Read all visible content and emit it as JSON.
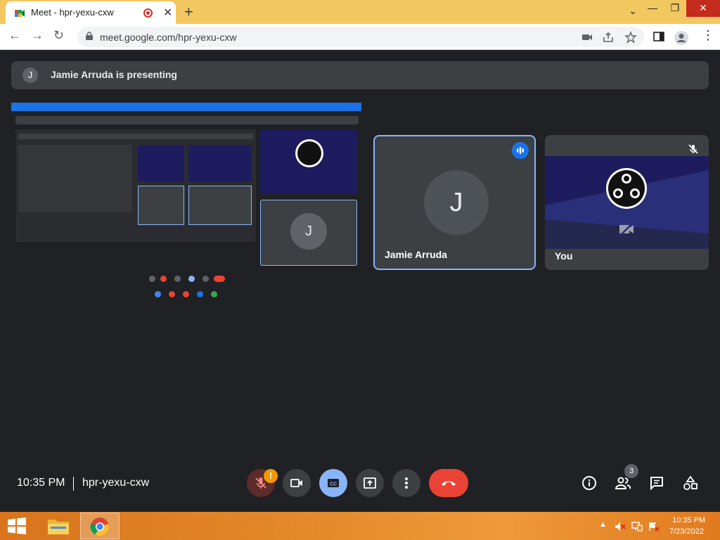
{
  "browser": {
    "tab_title": "Meet - hpr-yexu-cxw",
    "url": "meet.google.com/hpr-yexu-cxw"
  },
  "presenting_banner": {
    "avatar_letter": "J",
    "text": "Jamie Arruda is presenting"
  },
  "participants": [
    {
      "name": "Jamie Arruda",
      "avatar_letter": "J",
      "speaking": true
    },
    {
      "name": "You",
      "muted": true,
      "video": "obs-logo"
    }
  ],
  "bottom_bar": {
    "time": "10:35 PM",
    "meeting_code": "hpr-yexu-cxw",
    "mic_alert": "!",
    "people_count": "3"
  },
  "taskbar": {
    "time": "10:35 PM",
    "date": "7/23/2022"
  },
  "colors": {
    "meet_bg": "#202124",
    "tile_bg": "#3c4043",
    "accent_blue": "#8ab4f8",
    "end_call_red": "#ea4335",
    "tabstrip": "#f3c760"
  }
}
